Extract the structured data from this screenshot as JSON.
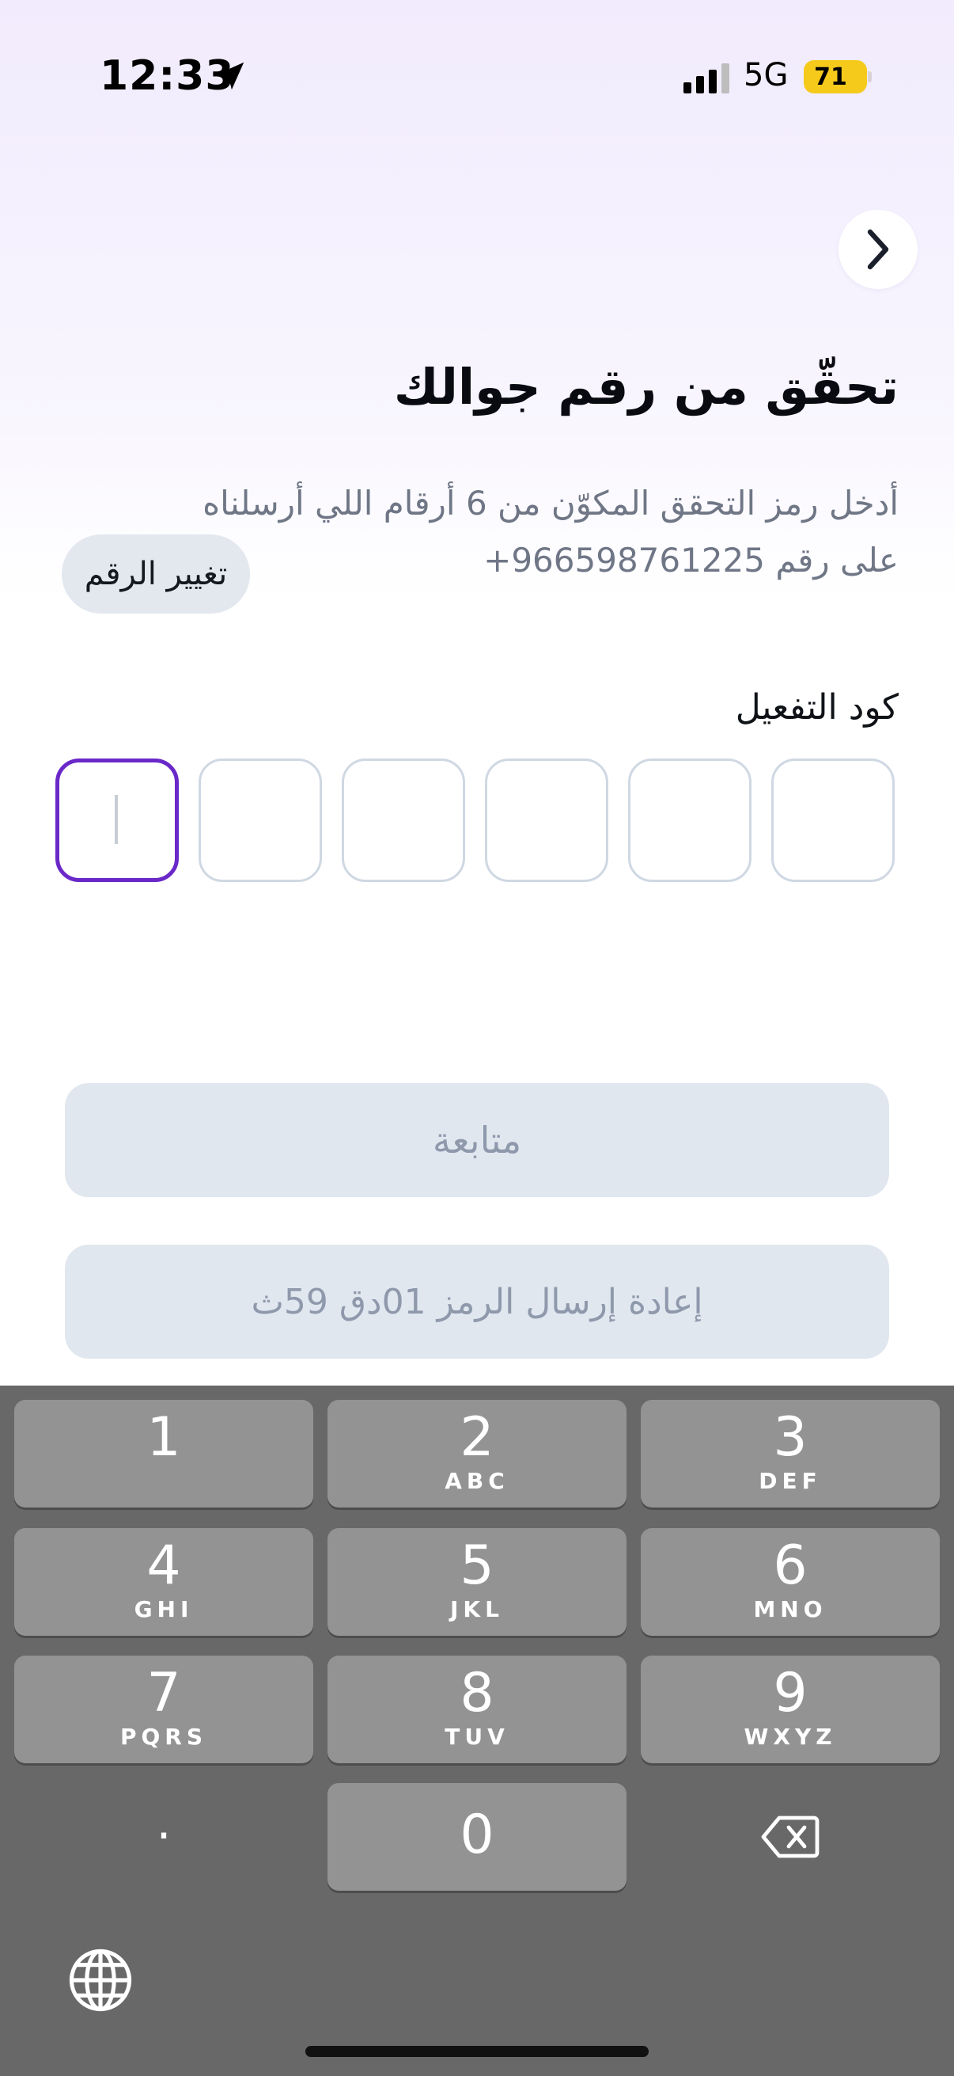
{
  "status_bar": {
    "time": "12:33",
    "network": "5G",
    "battery": "71",
    "battery_color": "#f5ca1b"
  },
  "header": {
    "back_icon": "chevron-right-icon"
  },
  "main": {
    "title": "تحقّق من رقم جوالك",
    "description_line1": "أدخل رمز التحقق المكوّن من 6 أرقام اللي أرسلناه",
    "description_prefix": "على رقم",
    "phone": "+966598761225",
    "change_number_label": "تغيير الرقم",
    "code_label": "كود التفعيل",
    "code_digits": [
      "",
      "",
      "",
      "",
      "",
      ""
    ],
    "continue_label": "متابعة",
    "resend_label": "إعادة إرسال الرمز 01دق 59ث",
    "accent_color": "#6a28c8"
  },
  "keyboard": {
    "keys": [
      {
        "num": "1",
        "letters": ""
      },
      {
        "num": "2",
        "letters": "ABC"
      },
      {
        "num": "3",
        "letters": "DEF"
      },
      {
        "num": "4",
        "letters": "GHI"
      },
      {
        "num": "5",
        "letters": "JKL"
      },
      {
        "num": "6",
        "letters": "MNO"
      },
      {
        "num": "7",
        "letters": "PQRS"
      },
      {
        "num": "8",
        "letters": "TUV"
      },
      {
        "num": "9",
        "letters": "WXYZ"
      },
      {
        "num": "0",
        "letters": ""
      }
    ],
    "decimal": ".",
    "delete_icon": "backspace-icon",
    "globe_icon": "globe-icon"
  }
}
